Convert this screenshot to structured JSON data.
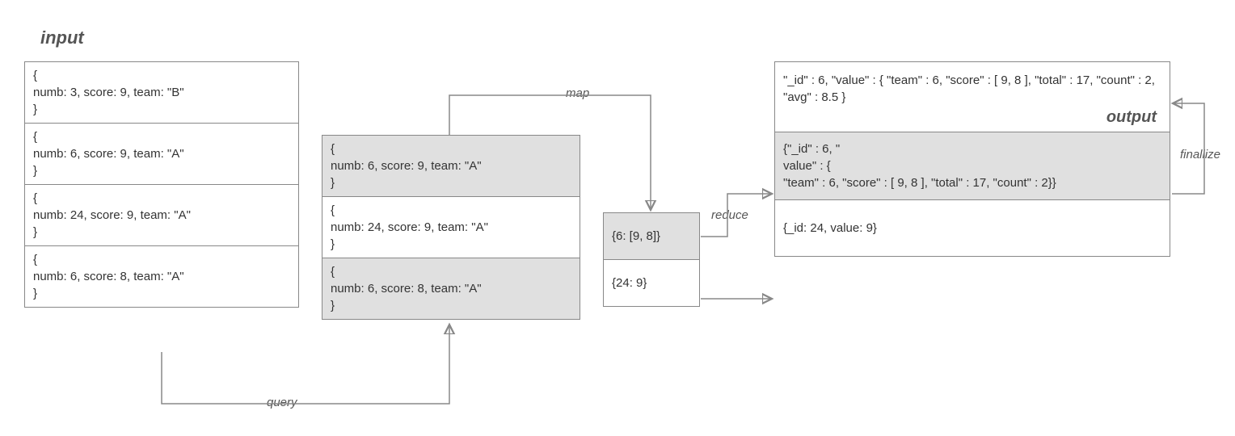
{
  "titles": {
    "input": "input",
    "output": "output"
  },
  "labels": {
    "query": "query",
    "map": "map",
    "reduce": "reduce",
    "finalize": "finallize"
  },
  "input": {
    "rows": [
      "{\nnumb: 3, score: 9, team: \"B\"\n}",
      "{\nnumb: 6, score: 9, team: \"A\"\n}",
      "{\nnumb: 24, score: 9, team: \"A\"\n}",
      "{\nnumb: 6, score: 8, team: \"A\"\n}"
    ]
  },
  "filtered": {
    "rows": [
      "{\nnumb: 6, score: 9, team: \"A\"\n}",
      "{\nnumb: 24, score: 9, team: \"A\"\n}",
      "{\nnumb: 6, score: 8, team: \"A\"\n}"
    ]
  },
  "mapped": {
    "rows": [
      "{6: [9, 8]}",
      "{24: 9}"
    ]
  },
  "output": {
    "rows": [
      "\"_id\" : 6, \"value\" : { \"team\" : 6, \"score\" : [ 9, 8 ], \"total\" : 17, \"count\" : 2, \"avg\" : 8.5 }",
      "{\"_id\" : 6, \"\nvalue\" : {\n \"team\" : 6, \"score\" : [ 9, 8 ], \"total\" : 17, \"count\" : 2}}",
      "{_id: 24, value: 9}"
    ]
  }
}
